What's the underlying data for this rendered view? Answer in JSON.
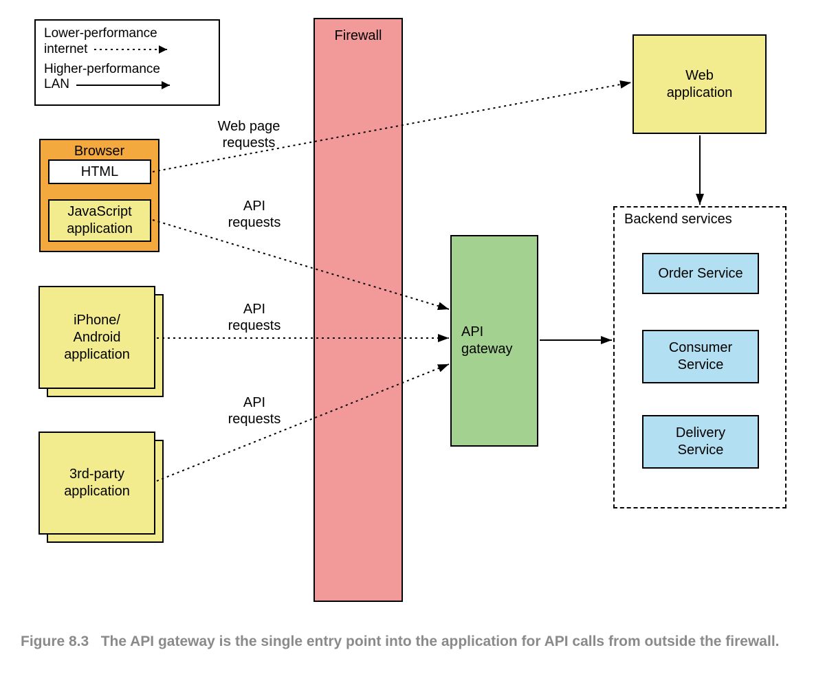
{
  "legend": {
    "item1_l1": "Lower-performance",
    "item1_l2": "internet",
    "item2_l1": "Higher-performance",
    "item2_l2": "LAN"
  },
  "clients": {
    "browser_title": "Browser",
    "html_label": "HTML",
    "js_l1": "JavaScript",
    "js_l2": "application",
    "mobile_l1": "iPhone/",
    "mobile_l2": "Android",
    "mobile_l3": "application",
    "thirdparty_l1": "3rd-party",
    "thirdparty_l2": "application"
  },
  "labels": {
    "web_page_requests_l1": "Web page",
    "web_page_requests_l2": "requests",
    "api_requests_l1": "API",
    "api_requests_l2": "requests"
  },
  "middle": {
    "firewall": "Firewall",
    "api_gateway_l1": "API",
    "api_gateway_l2": "gateway"
  },
  "right": {
    "webapp_l1": "Web",
    "webapp_l2": "application",
    "backend_title": "Backend services",
    "service1": "Order Service",
    "service2_l1": "Consumer",
    "service2_l2": "Service",
    "service3_l1": "Delivery",
    "service3_l2": "Service"
  },
  "caption": {
    "figure_num": "Figure 8.3",
    "text": "The API gateway is the single entry point into the application for API calls from outside the firewall."
  }
}
